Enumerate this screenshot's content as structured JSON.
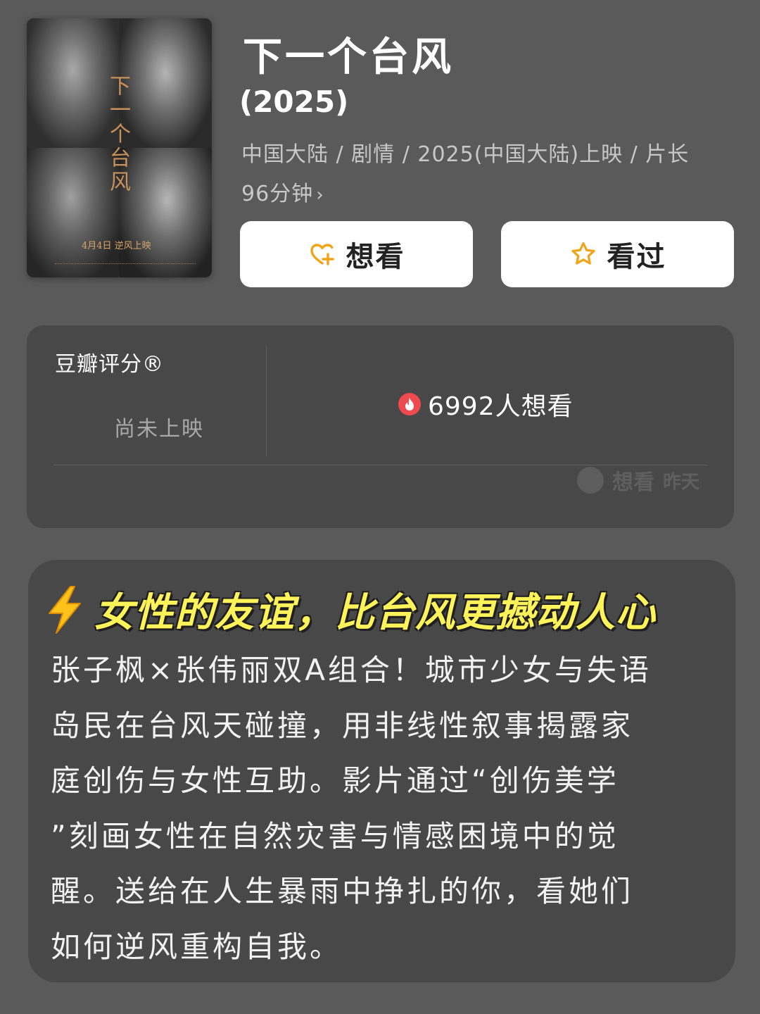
{
  "movie": {
    "title": "下一个台风",
    "year": "(2025)",
    "meta_line1": "中国大陆 / 剧情 / 2025(中国大陆)上映 / 片长",
    "meta_line2": "96分钟",
    "poster": {
      "title": "下一个台风",
      "release_note": "4月4日 逆风上映"
    }
  },
  "actions": {
    "want_label": "想看",
    "seen_label": "看过"
  },
  "rating": {
    "title": "豆瓣评分®",
    "status": "尚未上映",
    "want_count_text": "6992人想看",
    "faded_label": "想看",
    "faded_time": "昨天"
  },
  "review": {
    "headline": "女性的友谊，比台风更撼动人心",
    "body_lines": [
      "张子枫×张伟丽双A组合！城市少女与失语",
      "岛民在台风天碰撞，用非线性叙事揭露家",
      "庭创伤与女性互助。影片通过“创伤美学",
      "”刻画女性在自然灾害与情感困境中的觉",
      "醒。送给在人生暴雨中挣扎的你，看她们",
      "如何逆风重构自我。"
    ]
  },
  "colors": {
    "background": "#5a5a5a",
    "card": "#484848",
    "accent_orange": "#f2a418",
    "headline_yellow": "#fff35a",
    "hot_red": "#ef4a50"
  },
  "icons": {
    "want": "heart-plus-icon",
    "seen": "star-outline-icon",
    "hot": "fire-icon",
    "headline": "lightning-bolt-icon"
  }
}
